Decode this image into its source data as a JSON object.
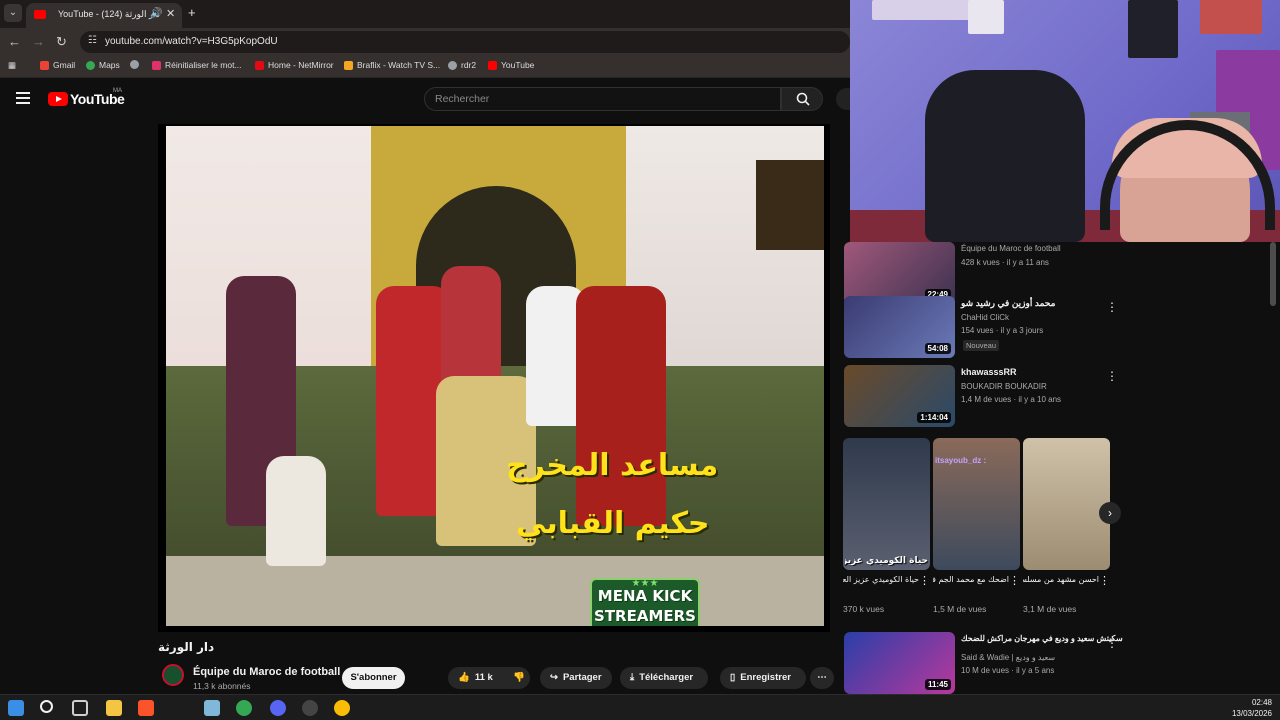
{
  "browser": {
    "tab": {
      "title": "YouTube - (124) دار الورثة",
      "audio_icon": "speaker-icon"
    },
    "url": "youtube.com/watch?v=H3G5pKopOdU",
    "bookmarks": [
      {
        "label": "Gmail",
        "color": "#ea4335"
      },
      {
        "label": "Maps",
        "color": "#34a853"
      },
      {
        "label": "",
        "color": "#9aa0a6"
      },
      {
        "label": "Réinitialiser le mot...",
        "color": "#e1306c"
      },
      {
        "label": "Home - NetMirror",
        "color": "#e50914"
      },
      {
        "label": "Braflix - Watch TV S...",
        "color": "#f5a623"
      },
      {
        "label": "rdr2",
        "color": "#9aa0a6"
      },
      {
        "label": "YouTube",
        "color": "#ff0000"
      }
    ]
  },
  "youtube": {
    "logo_text": "YouTube",
    "region": "MA",
    "search_placeholder": "Rechercher",
    "video": {
      "subtitle_line1": "مساعد المخرج",
      "subtitle_line2": "حكيم القبابي",
      "badge_line1": "MENA KICK",
      "badge_line2": "STREAMERS",
      "badge_stars": "★★★",
      "title": "دار الورثة",
      "channel": "Équipe du Maroc de football",
      "subscribers": "11,3 k abonnés",
      "subscribe_label": "S'abonner",
      "likes": "11 k",
      "share_label": "Partager",
      "download_label": "Télécharger",
      "save_label": "Enregistrer"
    },
    "recommendations": [
      {
        "title": "",
        "channel": "Équipe du Maroc de football",
        "meta": "428 k vues · il y a 11 ans",
        "duration": "22:49",
        "badge": "",
        "color": "#a0587a"
      },
      {
        "title": "محمد أوزين في رشيد شو",
        "channel": "ChaHid CliCk",
        "meta": "154 vues · il y a 3 jours",
        "duration": "54:08",
        "badge": "Nouveau",
        "color": "#3b3b72"
      },
      {
        "title": "khawasssRR",
        "channel": "BOUKADIR BOUKADIR",
        "meta": "1,4 M de vues · il y a 10 ans",
        "duration": "1:14:04",
        "badge": "",
        "color": "#6a4a2a"
      }
    ],
    "shorts": [
      {
        "overlay": "حياة الكوميدي عزيز",
        "title": "حياة الكوميدي عزيز العلوي كلها",
        "views": "370 k vues",
        "handle": "",
        "color": "#2f3a4c"
      },
      {
        "overlay": "",
        "title": "اضحك مع محمد الجم في مسرحية",
        "views": "1,5 M de vues",
        "handle": "itsayoub_dz :",
        "color": "#8a6a5a"
      },
      {
        "overlay": "",
        "title": "احسن مشهد من مسلسل كبور",
        "views": "3,1 M de vues",
        "handle": "",
        "color": "#cfc2a8"
      }
    ],
    "last_recommendation": {
      "title": "سكيتش سعيد و وديع في مهرجان مراكش للضحك",
      "channel": "Said & Wadie | سعيد و وديع",
      "meta": "10 M de vues · il y a 5 ans",
      "duration": "11:45",
      "color": "#2a3fa8"
    }
  },
  "taskbar": {
    "time": "02:48",
    "date": "13/03/2026",
    "apps": [
      {
        "name": "start",
        "color": "#3a8ee6"
      },
      {
        "name": "search",
        "color": "#f1f1f1"
      },
      {
        "name": "task-view",
        "color": "#cfcfcf"
      },
      {
        "name": "file-explorer",
        "color": "#f4c542"
      },
      {
        "name": "brave",
        "color": "#fb542b"
      },
      {
        "name": "notepad",
        "color": "#7fb8d8"
      },
      {
        "name": "chrome",
        "color": "#34a853"
      },
      {
        "name": "discord",
        "color": "#5865f2"
      },
      {
        "name": "obs",
        "color": "#444444"
      },
      {
        "name": "chrome-2",
        "color": "#fbbc05"
      }
    ]
  }
}
